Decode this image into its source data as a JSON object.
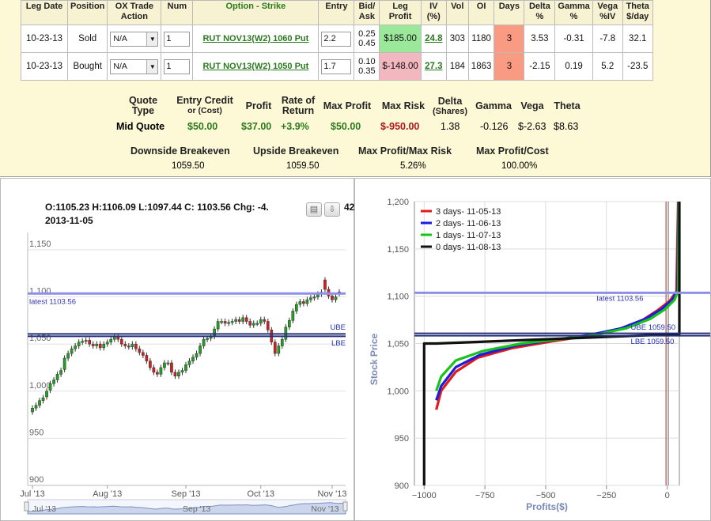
{
  "legs_table": {
    "headers": [
      "Leg Date",
      "Position",
      "OX Trade Action",
      "Num",
      "Option - Strike",
      "Entry",
      "Bid/ Ask",
      "Leg Profit",
      "IV (%)",
      "Vol",
      "OI",
      "Days",
      "Delta %",
      "Gamma %",
      "Vega %IV",
      "Theta $/day"
    ],
    "rows": [
      {
        "leg_date": "10-23-13",
        "position": "Sold",
        "action": "N/A",
        "num": "1",
        "option": "RUT NOV13(W2) 1060 Put",
        "entry": "2.2",
        "bid": "0.25",
        "ask": "0.45",
        "profit": "$185.00",
        "iv": "24.8",
        "vol": "303",
        "oi": "1180",
        "days": "3",
        "delta": "3.53",
        "gamma": "-0.31",
        "vega": "-7.8",
        "theta": "32.1"
      },
      {
        "leg_date": "10-23-13",
        "position": "Bought",
        "action": "N/A",
        "num": "1",
        "option": "RUT NOV13(W2) 1050 Put",
        "entry": "1.7",
        "bid": "0.10",
        "ask": "0.35",
        "profit": "$-148.00",
        "iv": "27.3",
        "vol": "184",
        "oi": "1863",
        "days": "3",
        "delta": "-2.15",
        "gamma": "0.19",
        "vega": "5.2",
        "theta": "-23.5"
      }
    ]
  },
  "quote_summary": {
    "h_quote": "Quote Type",
    "h_credit": "Entry Credit",
    "h_credit_sub": "or (Cost)",
    "h_profit": "Profit",
    "h_ror": "Rate of Return",
    "h_maxp": "Max Profit",
    "h_maxr": "Max Risk",
    "h_delta": "Delta",
    "h_delta_sub": "(Shares)",
    "h_gamma": "Gamma",
    "h_vega": "Vega",
    "h_theta": "Theta",
    "quote_type": "Mid Quote",
    "credit": "$50.00",
    "profit": "$37.00",
    "ror": "+3.9%",
    "max_profit": "$50.00",
    "max_risk": "$-950.00",
    "delta": "1.38",
    "gamma": "-0.126",
    "vega": "$-2.63",
    "theta": "$8.63"
  },
  "breakevens": {
    "h_down": "Downside Breakeven",
    "h_up": "Upside Breakeven",
    "h_ratio": "Max Profit/Max Risk",
    "h_cost": "Max Profit/Cost",
    "down": "1059.50",
    "up": "1059.50",
    "ratio": "5.26%",
    "cost": "100.00%"
  },
  "price_chart": {
    "ohlc": "O:1105.23 H:1106.09 L:1097.44 C: 1103.56 Chg: -4.",
    "ohlc_tail": "42",
    "date": "2013-11-05",
    "latest_label": "latest 1103.56",
    "ube_label": "UBE",
    "lbe_label": "LBE",
    "nav_labels": [
      "Jul '13",
      "Sep '13",
      "Nov '13"
    ]
  },
  "colors": {
    "accent_green": "#2a7a1e",
    "loss_red": "#b0141c",
    "panel_bg": "#fdf8d6",
    "line_blue": "#8e8fe8",
    "line_navy": "#26307a"
  },
  "chart_data": [
    {
      "type": "candlestick",
      "title": "",
      "ylim": [
        900,
        1160
      ],
      "yticks": [
        900,
        950,
        1000,
        1050,
        1100,
        1150
      ],
      "ytick_labels": [
        "900",
        "950",
        "1,000",
        "1,050",
        "1,100",
        "1,150"
      ],
      "xtick_labels": [
        "Jul '13",
        "Aug '13",
        "Sep '13",
        "Oct '13",
        "Nov '13"
      ],
      "latest": 1103.56,
      "ube": 1059.5,
      "lbe": 1059.5,
      "close": [
        982,
        985,
        990,
        993,
        1000,
        1008,
        1012,
        1018,
        1022,
        1035,
        1040,
        1045,
        1048,
        1052,
        1053,
        1054,
        1050,
        1048,
        1050,
        1046,
        1050,
        1052,
        1055,
        1058,
        1055,
        1050,
        1048,
        1047,
        1050,
        1045,
        1041,
        1038,
        1032,
        1025,
        1020,
        1018,
        1025,
        1030,
        1030,
        1020,
        1016,
        1020,
        1022,
        1028,
        1032,
        1036,
        1040,
        1048,
        1055,
        1056,
        1058,
        1066,
        1074,
        1074,
        1072,
        1073,
        1074,
        1076,
        1074,
        1078,
        1074,
        1070,
        1072,
        1072,
        1076,
        1074,
        1065,
        1052,
        1040,
        1048,
        1055,
        1068,
        1075,
        1085,
        1092,
        1095,
        1093,
        1097,
        1099,
        1100,
        1103,
        1105,
        1108,
        1101,
        1097,
        1100,
        1103.56
      ],
      "open": [
        978,
        982,
        985,
        990,
        994,
        1001,
        1008,
        1012,
        1018,
        1023,
        1035,
        1040,
        1045,
        1048,
        1052,
        1053,
        1054,
        1050,
        1048,
        1050,
        1046,
        1050,
        1052,
        1055,
        1058,
        1055,
        1050,
        1048,
        1047,
        1050,
        1045,
        1041,
        1038,
        1032,
        1025,
        1020,
        1018,
        1025,
        1030,
        1030,
        1020,
        1016,
        1020,
        1022,
        1028,
        1032,
        1036,
        1040,
        1048,
        1055,
        1056,
        1058,
        1066,
        1074,
        1074,
        1072,
        1073,
        1074,
        1076,
        1074,
        1078,
        1074,
        1070,
        1072,
        1072,
        1076,
        1074,
        1065,
        1052,
        1040,
        1048,
        1055,
        1068,
        1075,
        1085,
        1092,
        1095,
        1093,
        1097,
        1099,
        1100,
        1103,
        1118,
        1108,
        1101,
        1097,
        1105.23
      ]
    },
    {
      "type": "line",
      "title": "",
      "xlabel": "Profits($)",
      "ylabel": "Stock Price",
      "xlim": [
        -1040,
        50
      ],
      "ylim": [
        900,
        1200
      ],
      "xticks": [
        -1000,
        -750,
        -500,
        -250,
        0
      ],
      "xtick_labels": [
        "−1000",
        "−750",
        "−500",
        "−250",
        "0"
      ],
      "yticks": [
        900,
        950,
        1000,
        1050,
        1100,
        1150,
        1200
      ],
      "ytick_labels": [
        "900",
        "950",
        "1,000",
        "1,050",
        "1,100",
        "1,150",
        "1,200"
      ],
      "latest": 1103.56,
      "ube": 1059.5,
      "lbe": 1059.5,
      "latest_label": "latest 1103.56",
      "ube_label": "UBE 1059.50",
      "lbe_label": "LBE 1059.50",
      "legend_position": "top-left",
      "series": [
        {
          "name": "3 days- 11-05-13",
          "color": "#e11b1b",
          "x": [
            -950,
            -930,
            -870,
            -780,
            -640,
            -480,
            -330,
            -200,
            -100,
            -40,
            10,
            38,
            45
          ],
          "y": [
            980,
            1000,
            1020,
            1035,
            1045,
            1052,
            1058,
            1065,
            1075,
            1085,
            1095,
            1105,
            1200
          ]
        },
        {
          "name": "2 days- 11-06-13",
          "color": "#1b1be1",
          "x": [
            -950,
            -930,
            -870,
            -770,
            -620,
            -460,
            -320,
            -190,
            -90,
            -25,
            20,
            42,
            47
          ],
          "y": [
            990,
            1005,
            1025,
            1038,
            1048,
            1054,
            1059,
            1066,
            1076,
            1086,
            1096,
            1106,
            1200
          ]
        },
        {
          "name": "1 days- 11-07-13",
          "color": "#19c319",
          "x": [
            -950,
            -930,
            -870,
            -760,
            -600,
            -430,
            -300,
            -170,
            -70,
            -10,
            30,
            45,
            48
          ],
          "y": [
            1000,
            1015,
            1032,
            1042,
            1050,
            1055,
            1059,
            1066,
            1076,
            1086,
            1096,
            1106,
            1200
          ]
        },
        {
          "name": "0 days- 11-08-13",
          "color": "#111111",
          "x": [
            -1000,
            -1000,
            -950,
            -950,
            50,
            50
          ],
          "y": [
            900,
            1050,
            1050,
            1050,
            1060,
            1200
          ]
        }
      ]
    }
  ]
}
